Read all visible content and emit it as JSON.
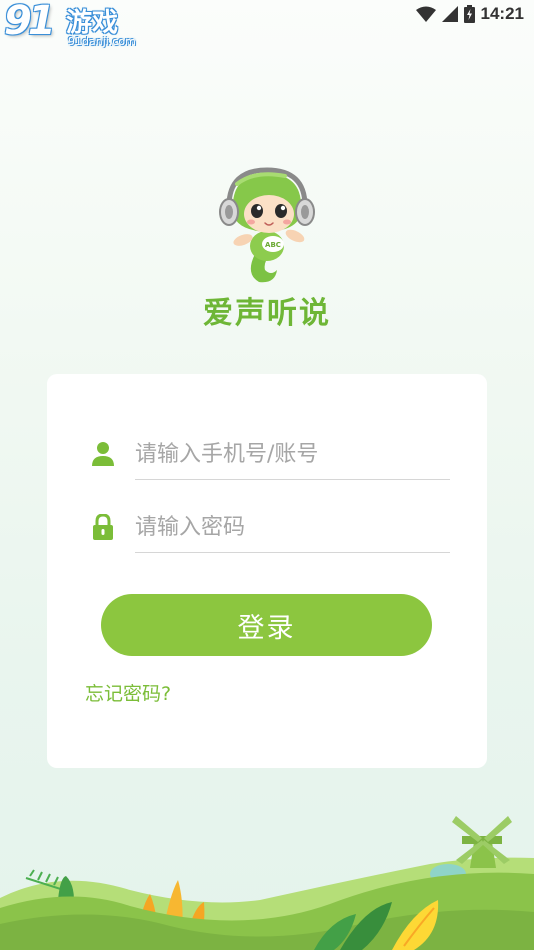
{
  "status_bar": {
    "time": "14:21",
    "icons": [
      "wifi-icon",
      "cell-signal-icon",
      "battery-charging-icon"
    ]
  },
  "watermark": {
    "number": "91",
    "text": "游戏",
    "url": "91danji.com"
  },
  "app": {
    "name": "爱声听说",
    "mascot_badge": "ABC"
  },
  "login_form": {
    "account_placeholder": "请输入手机号/账号",
    "password_placeholder": "请输入密码",
    "login_label": "登录",
    "forgot_label": "忘记密码?"
  },
  "colors": {
    "accent": "#8cc63f",
    "app_name": "#6eb636",
    "link": "#7bbd38"
  }
}
